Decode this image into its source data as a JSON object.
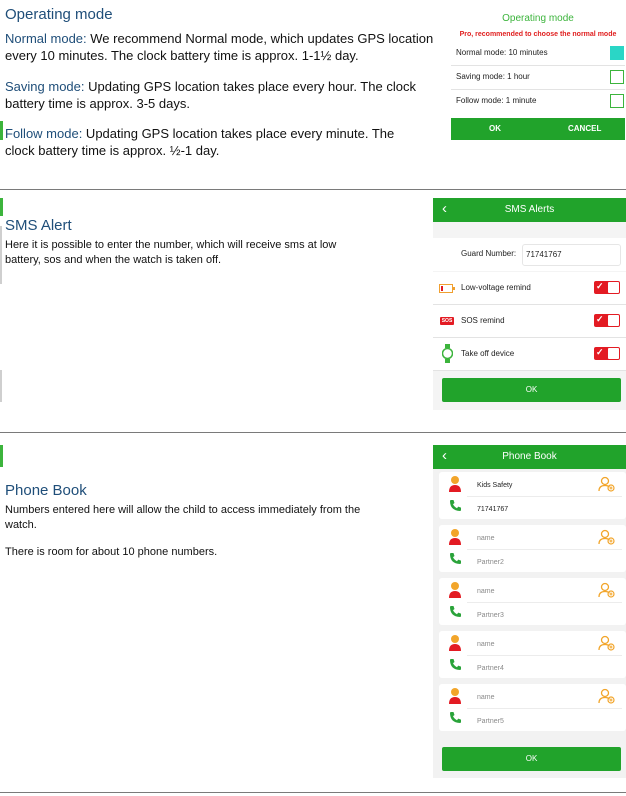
{
  "section1": {
    "heading": "Operating mode",
    "normal_label": "Normal mode:",
    "normal_text_line1": " We recommend Normal mode, which updates GPS location",
    "normal_text_line2": "every 10 minutes. The clock battery time is approx. 1-1½ day.",
    "saving_label": "Saving mode:",
    "saving_text_line1": " Updating GPS location takes place every hour. The clock",
    "saving_text_line2": "battery time is approx. 3-5 days.",
    "follow_label": "Follow mode:",
    "follow_text_line1": " Updating GPS location takes place every minute. The",
    "follow_text_line2": "clock battery time is approx. ½-1 day."
  },
  "mode_dialog": {
    "title": "Operating mode",
    "subtitle": "Pro, recommended to choose the normal mode",
    "options": [
      {
        "label": "Normal mode: 10 minutes",
        "checked": true
      },
      {
        "label": "Saving mode: 1 hour",
        "checked": false
      },
      {
        "label": "Follow mode: 1 minute",
        "checked": false
      }
    ],
    "ok": "OK",
    "cancel": "CANCEL"
  },
  "section2": {
    "heading": "SMS Alert",
    "text_line1": "Here it is possible to enter the number, which will receive sms at low",
    "text_line2": "battery, sos and when the watch is taken off."
  },
  "sms_screen": {
    "back": "‹",
    "title": "SMS Alerts",
    "guard_label": "Guard Number:",
    "guard_value": "71741767",
    "sos_icon_text": "SOS",
    "rows": [
      {
        "label": "Low-voltage remind",
        "icon": "battery-icon",
        "on": true
      },
      {
        "label": "SOS remind",
        "icon": "sos-icon",
        "on": true
      },
      {
        "label": "Take off device",
        "icon": "watch-icon",
        "on": true
      }
    ],
    "ok": "OK"
  },
  "section3": {
    "heading": "Phone Book",
    "text_line1": "Numbers entered here will allow the child to access immediately from the",
    "text_line2": "watch.",
    "text_line3": "There is room for about 10 phone numbers."
  },
  "phonebook_screen": {
    "back": "‹",
    "title": "Phone Book",
    "contacts": [
      {
        "name": "Kids Safety",
        "number": "71741767"
      },
      {
        "name": "name",
        "number": "Partner2"
      },
      {
        "name": "name",
        "number": "Partner3"
      },
      {
        "name": "name",
        "number": "Partner4"
      },
      {
        "name": "name",
        "number": "Partner5"
      }
    ],
    "ok": "OK"
  },
  "colors": {
    "green": "#21a32b",
    "red": "#e31b23",
    "teal": "#2ad6c6",
    "heading_blue": "#1f4e79"
  }
}
